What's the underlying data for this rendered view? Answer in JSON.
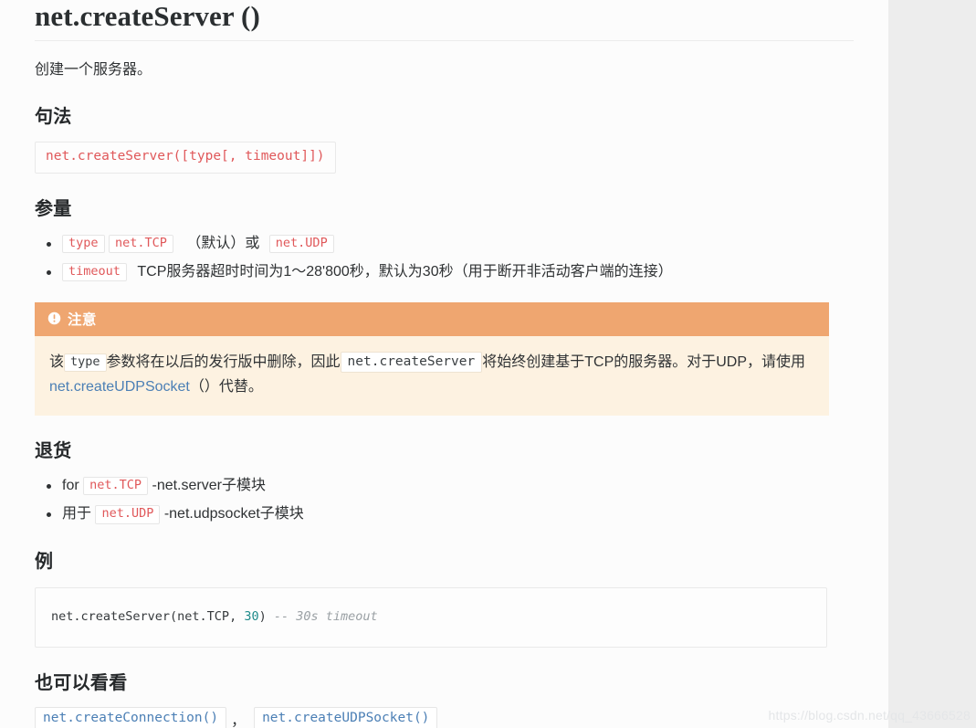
{
  "page": {
    "title": "net.createServer ()",
    "intro": "创建一个服务器。"
  },
  "sections": {
    "syntax": {
      "heading": "句法",
      "code": "net.createServer([type[, timeout]])"
    },
    "parameters": {
      "heading": "参量",
      "items": [
        {
          "code": "type",
          "code2": "net.TCP",
          "mid": "（默认）或",
          "code3": "net.UDP"
        },
        {
          "code": "timeout",
          "text": "TCP服务器超时时间为1〜28'800秒，默认为30秒（用于断开非活动客户端的连接）"
        }
      ]
    },
    "note": {
      "icon": "exclamation-circle-icon",
      "heading": "注意",
      "text_1": "该",
      "code_1": "type",
      "text_2": "参数将在以后的发行版中删除，因此",
      "code_2": "net.createServer",
      "text_3": "将始终创建基于TCP的服务器。对于UDP，请使用",
      "link": "net.createUDPSocket",
      "text_4": "（）代替。",
      "header_bg": "#efa670",
      "body_bg": "#fdf2e1",
      "link_color": "#4b7fb5"
    },
    "returns": {
      "heading": "退货",
      "items": [
        {
          "pre": "for",
          "code": "net.TCP",
          "post": "-net.server子模块"
        },
        {
          "pre": "用于",
          "code": "net.UDP",
          "post": "-net.udpsocket子模块"
        }
      ]
    },
    "example": {
      "heading": "例",
      "code_main": "net.createServer(net.TCP, ",
      "code_num": "30",
      "code_close": ") ",
      "code_comment": "-- 30s timeout"
    },
    "see_also": {
      "heading": "也可以看看",
      "links": [
        "net.createConnection()",
        "net.createUDPSocket()"
      ],
      "separator": "，"
    }
  },
  "watermark": "https://blog.csdn.net/qq_43666528"
}
